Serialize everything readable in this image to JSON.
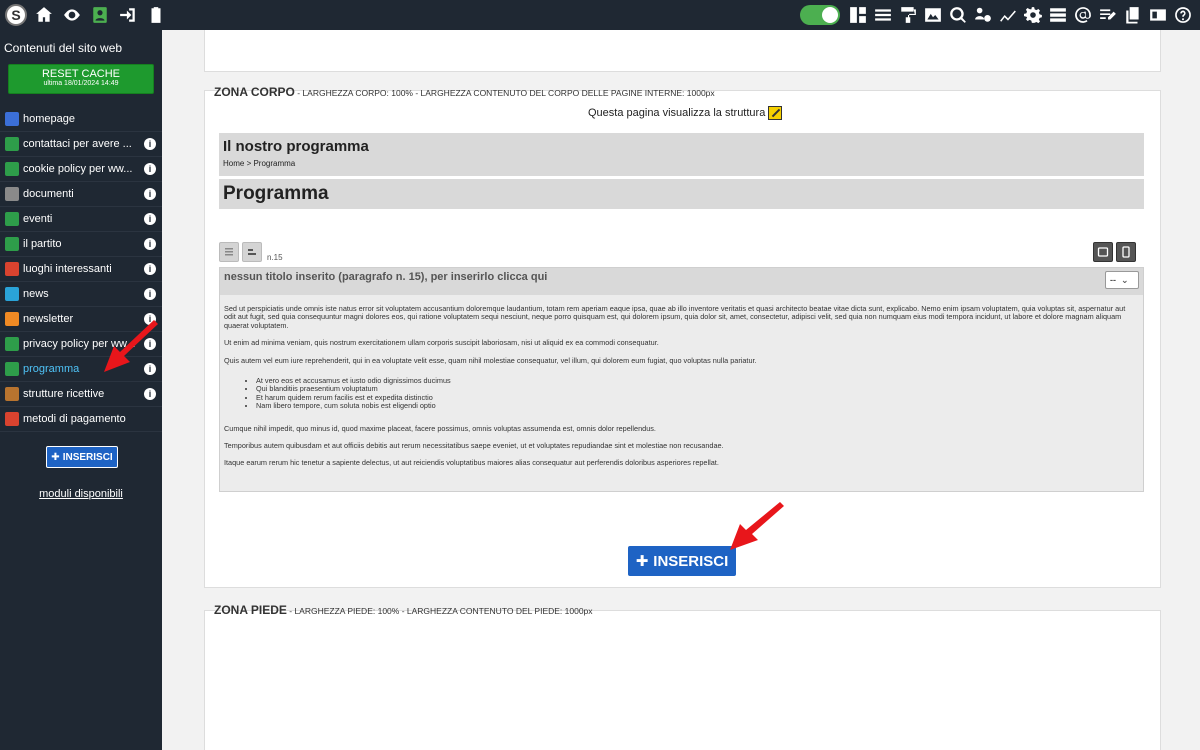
{
  "topbar": {
    "logo": "S",
    "left_icons": [
      "home-icon",
      "eye-icon",
      "contact-card-icon",
      "login-icon",
      "clipboard-icon"
    ],
    "right_icons": [
      "layout-icon",
      "menu-icon",
      "paint-roller-icon",
      "image-icon",
      "search-globe-icon",
      "users-gear-icon",
      "chart-line-icon",
      "gear-icon",
      "list-icon",
      "at-icon",
      "edit-list-icon",
      "files-icon",
      "id-card-icon",
      "help-icon"
    ]
  },
  "sidebar": {
    "title": "Contenuti del sito web",
    "reset_label": "RESET CACHE",
    "reset_sub": "ultima 18/01/2024 14:49",
    "items": [
      {
        "label": "homepage",
        "color": "#3b6fd8",
        "info": false
      },
      {
        "label": "contattaci per avere ...",
        "color": "#2e9d4a",
        "info": true
      },
      {
        "label": "cookie policy per ww...",
        "color": "#2e9d4a",
        "info": true
      },
      {
        "label": "documenti",
        "color": "#8a8a8a",
        "info": true
      },
      {
        "label": "eventi",
        "color": "#2e9d4a",
        "info": true
      },
      {
        "label": "il partito",
        "color": "#2e9d4a",
        "info": true
      },
      {
        "label": "luoghi interessanti",
        "color": "#d9432f",
        "info": true
      },
      {
        "label": "news",
        "color": "#2aa3d8",
        "info": true
      },
      {
        "label": "newsletter",
        "color": "#f08a24",
        "info": true
      },
      {
        "label": "privacy policy per ww...",
        "color": "#2e9d4a",
        "info": true
      },
      {
        "label": "programma",
        "color": "#2e9d4a",
        "info": true,
        "active": true
      },
      {
        "label": "strutture ricettive",
        "color": "#b8742f",
        "info": true
      },
      {
        "label": "metodi di pagamento",
        "color": "#d9432f",
        "info": false
      }
    ],
    "insert_label": "INSERISCI",
    "moduli_label": "moduli disponibili"
  },
  "main": {
    "corpo_title": "ZONA CORPO",
    "corpo_sub": " - LARGHEZZA CORPO: 100% - LARGHEZZA CONTENUTO DEL CORPO DELLE PAGINE INTERNE: 1000px",
    "structure_note": "Questa pagina visualizza la struttura",
    "page_heading": "Il nostro programma",
    "breadcrumb": "Home > Programma",
    "program_heading": "Programma",
    "para_count": "n.15",
    "para_title": "nessun titolo inserito (paragrafo n. 15), per inserirlo clicca qui",
    "para_select": "--",
    "para_texts": [
      "Sed ut perspiciatis unde omnis iste natus error sit voluptatem accusantium doloremque laudantium, totam rem aperiam eaque ipsa, quae ab illo inventore veritatis et quasi architecto beatae vitae dicta sunt, explicabo. Nemo enim ipsam voluptatem, quia voluptas sit, aspernatur aut odit aut fugit, sed quia consequuntur magni dolores eos, qui ratione voluptatem sequi nesciunt, neque porro quisquam est, qui dolorem ipsum, quia dolor sit, amet, consectetur, adipisci velit, sed quia non numquam eius modi tempora incidunt, ut labore et dolore magnam aliquam quaerat voluptatem.",
      "Ut enim ad minima veniam, quis nostrum exercitationem ullam corporis suscipit laboriosam, nisi ut aliquid ex ea commodi consequatur.",
      "Quis autem vel eum iure reprehenderit, qui in ea voluptate velit esse, quam nihil molestiae consequatur, vel illum, qui dolorem eum fugiat, quo voluptas nulla pariatur."
    ],
    "para_list": [
      "At vero eos et accusamus et iusto odio dignissimos ducimus",
      "Qui blanditiis praesentium voluptatum",
      "Et harum quidem rerum facilis est et expedita distinctio",
      "Nam libero tempore, cum soluta nobis est eligendi optio"
    ],
    "para_texts_after": [
      "Cumque nihil impedit, quo minus id, quod maxime placeat, facere possimus, omnis voluptas assumenda est, omnis dolor repellendus.",
      "Temporibus autem quibusdam et aut officiis debitis aut rerum necessitatibus saepe eveniet, ut et voluptates repudiandae sint et molestiae non recusandae.",
      "Itaque earum rerum hic tenetur a sapiente delectus, ut aut reiciendis voluptatibus maiores alias consequatur aut perferendis doloribus asperiores repellat."
    ],
    "insert_label": "INSERISCI",
    "piede_title": "ZONA PIEDE",
    "piede_sub": " - LARGHEZZA PIEDE: 100% - LARGHEZZA CONTENUTO DEL PIEDE: 1000px"
  },
  "colors": {
    "dark_bg": "#1f2833",
    "accent_green": "#1e9a2e",
    "accent_blue": "#1e63c4",
    "arrow_red": "#e8161b",
    "active_text": "#4fc3f7"
  }
}
